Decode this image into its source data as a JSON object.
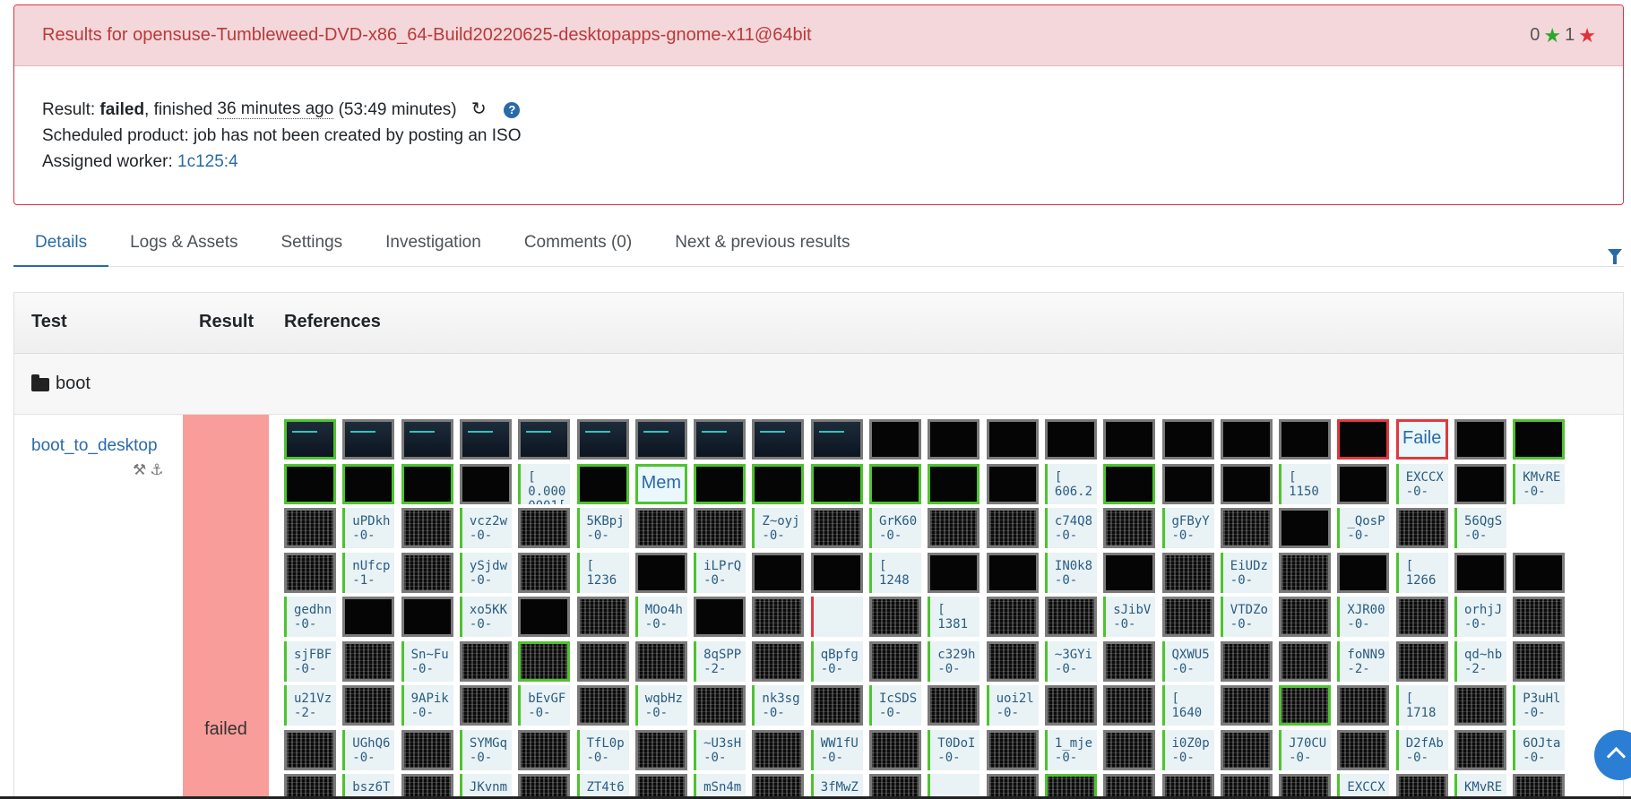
{
  "panel": {
    "title": "Results for opensuse-Tumbleweed-DVD-x86_64-Build20220625-desktopapps-gnome-x11@64bit",
    "stars_green_count": "0",
    "stars_red_count": "1",
    "result_label": "Result:",
    "result_value": "failed",
    "finished_label": ", finished",
    "finished_ago": "36 minutes ago",
    "duration": "(53:49 minutes)",
    "scheduled_product": "Scheduled product: job has not been created by posting an ISO",
    "worker_label": "Assigned worker:",
    "worker_value": "1c125:4",
    "help_icon": "?"
  },
  "tabs": [
    {
      "label": "Details",
      "active": true
    },
    {
      "label": "Logs & Assets"
    },
    {
      "label": "Settings"
    },
    {
      "label": "Investigation"
    },
    {
      "label": "Comments (0)"
    },
    {
      "label": "Next & previous results"
    }
  ],
  "table": {
    "headers": {
      "test": "Test",
      "result": "Result",
      "references": "References"
    },
    "group": "boot",
    "test_name": "boot_to_desktop",
    "test_icons": "⚒⚓",
    "result": "failed"
  },
  "grid_rows": [
    [
      "screen-good",
      "screen",
      "screen",
      "screen",
      "screen",
      "screen",
      "screen",
      "screen",
      "screen",
      "screen",
      "black",
      "black",
      "black",
      "black",
      "black",
      "black",
      "black",
      "black",
      "black-bad",
      "big-bad:Faile",
      "black",
      "black-good"
    ],
    [
      "black-good",
      "black-good",
      "black-good",
      "black",
      "txt:[\n0.000\n0001[",
      "black-good",
      "big:Mem",
      "black-good",
      "black-good",
      "black-good",
      "black-good",
      "black-good",
      "black",
      "txt:[\n606.2",
      "black-good",
      "black",
      "black",
      "txt:[\n1150",
      "black",
      "txt:EXCCX\n-0-",
      "black",
      "txt:KMvRE\n-0-"
    ],
    [
      "noise",
      "txt:uPDkh\n-0-",
      "noise",
      "txt:vcz2w\n-0-",
      "noise",
      "txt:5KBpj\n-0-",
      "noise",
      "noise",
      "txt:Z~oyj\n-0-",
      "noise",
      "txt:GrK60\n-0-",
      "noise",
      "noise",
      "txt:c74Q8\n-0-",
      "noise",
      "txt:gFByY\n-0-",
      "noise",
      "black",
      "txt:_QosP\n-0-",
      "noise",
      "txt:56QgS\n-0-"
    ],
    [
      "noise",
      "txt:nUfcp\n-1-",
      "noise",
      "txt:ySjdw\n-0-",
      "noise",
      "txt:[\n1236",
      "black",
      "txt:iLPrQ\n-0-",
      "black",
      "black",
      "txt:[\n1248",
      "black",
      "black",
      "txt:IN0k8\n-0-",
      "black",
      "noise",
      "txt:EiUDz\n-0-",
      "noise",
      "black",
      "txt:[\n1266",
      "black",
      "black"
    ],
    [
      "txt:gedhn\n-0-",
      "black",
      "black",
      "txt:xo5KK\n-0-",
      "black",
      "noise",
      "txt:MOo4h\n-0-",
      "black",
      "noise",
      "txtbad:",
      "noise",
      "txt:[\n1381",
      "noise",
      "noise",
      "txt:sJibV\n-0-",
      "noise",
      "txt:VTDZo\n-0-",
      "noise",
      "txt:XJR00\n-0-",
      "noise",
      "txt:orhjJ\n-0-",
      "noise"
    ],
    [
      "txt:sjFBF\n-0-",
      "noise",
      "txt:Sn~Fu\n-0-",
      "noise",
      "noise-good",
      "noise",
      "noise",
      "txt:8qSPP\n-2-",
      "noise",
      "txt:qBpfg\n-0-",
      "noise",
      "txt:c329h\n-0-",
      "noise",
      "txt:~3GYi\n-0-",
      "noise",
      "txt:QXWU5\n-0-",
      "noise",
      "noise",
      "txt:foNN9\n-2-",
      "noise",
      "txt:qd~hb\n-2-",
      "noise"
    ],
    [
      "txt:u21Vz\n-2-",
      "noise",
      "txt:9APik\n-0-",
      "noise",
      "txt:bEvGF\n-0-",
      "noise",
      "txt:wqbHz\n-0-",
      "noise",
      "txt:nk3sg\n-0-",
      "noise",
      "txt:IcSDS\n-0-",
      "noise",
      "txt:uoi2l\n-0-",
      "noise",
      "noise",
      "txt:[\n1640",
      "noise",
      "noise-good",
      "noise",
      "txt:[\n1718",
      "noise",
      "txt:P3uHl\n-0-"
    ],
    [
      "noise",
      "txt:UGhQ6\n-0-",
      "noise",
      "txt:SYMGq\n-0-",
      "noise",
      "txt:TfL0p\n-0-",
      "noise",
      "txt:~U3sH\n-0-",
      "noise",
      "txt:WW1fU\n-0-",
      "noise",
      "txt:T0DoI\n-0-",
      "noise",
      "txt:1_mje\n-0-",
      "noise",
      "txt:i0Z0p\n-0-",
      "noise",
      "txt:J70CU\n-0-",
      "noise",
      "txt:D2fAb\n-0-",
      "noise",
      "txt:6OJta\n-0-"
    ],
    [
      "noise",
      "txt:bsz6T\n",
      "noise",
      "txt:JKvnm\n",
      "noise",
      "txt:ZT4t6\n",
      "noise",
      "txt:mSn4m\n",
      "noise",
      "txt:3fMwZ\n",
      "noise",
      "txt:\n",
      "noise",
      "noise-good",
      "noise",
      "noise",
      "noise",
      "noise",
      "txt:EXCCX\n",
      "noise",
      "txt:KMvRE\n",
      "noise"
    ]
  ]
}
